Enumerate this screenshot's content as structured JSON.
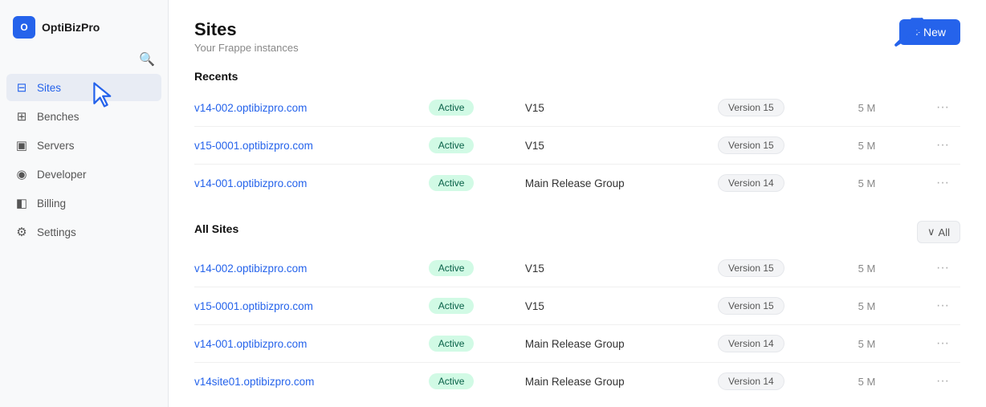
{
  "sidebar": {
    "logo_text": "OptiBizPro",
    "items": [
      {
        "id": "sites",
        "label": "Sites",
        "icon": "▦",
        "active": true
      },
      {
        "id": "benches",
        "label": "Benches",
        "icon": "⊞",
        "active": false
      },
      {
        "id": "servers",
        "label": "Servers",
        "icon": "⬛",
        "active": false
      },
      {
        "id": "developer",
        "label": "Developer",
        "icon": "◉",
        "active": false
      },
      {
        "id": "billing",
        "label": "Billing",
        "icon": "◧",
        "active": false
      },
      {
        "id": "settings",
        "label": "Settings",
        "icon": "⚙",
        "active": false
      }
    ]
  },
  "page": {
    "title": "Sites",
    "subtitle": "Your Frappe instances",
    "new_button": "+ New"
  },
  "recents": {
    "section_title": "Recents",
    "rows": [
      {
        "site": "v14-002.optibizpro.com",
        "status": "Active",
        "group": "V15",
        "version": "Version 15",
        "size": "5 M"
      },
      {
        "site": "v15-0001.optibizpro.com",
        "status": "Active",
        "group": "V15",
        "version": "Version 15",
        "size": "5 M"
      },
      {
        "site": "v14-001.optibizpro.com",
        "status": "Active",
        "group": "Main Release Group",
        "version": "Version 14",
        "size": "5 M"
      }
    ]
  },
  "all_sites": {
    "section_title": "All Sites",
    "filter_label": "All",
    "rows": [
      {
        "site": "v14-002.optibizpro.com",
        "status": "Active",
        "group": "V15",
        "version": "Version 15",
        "size": "5 M"
      },
      {
        "site": "v15-0001.optibizpro.com",
        "status": "Active",
        "group": "V15",
        "version": "Version 15",
        "size": "5 M"
      },
      {
        "site": "v14-001.optibizpro.com",
        "status": "Active",
        "group": "Main Release Group",
        "version": "Version 14",
        "size": "5 M"
      },
      {
        "site": "v14site01.optibizpro.com",
        "status": "Active",
        "group": "Main Release Group",
        "version": "Version 14",
        "size": "5 M"
      }
    ]
  },
  "colors": {
    "accent": "#2563eb",
    "active_bg": "#d1fae5",
    "active_text": "#065f46"
  }
}
